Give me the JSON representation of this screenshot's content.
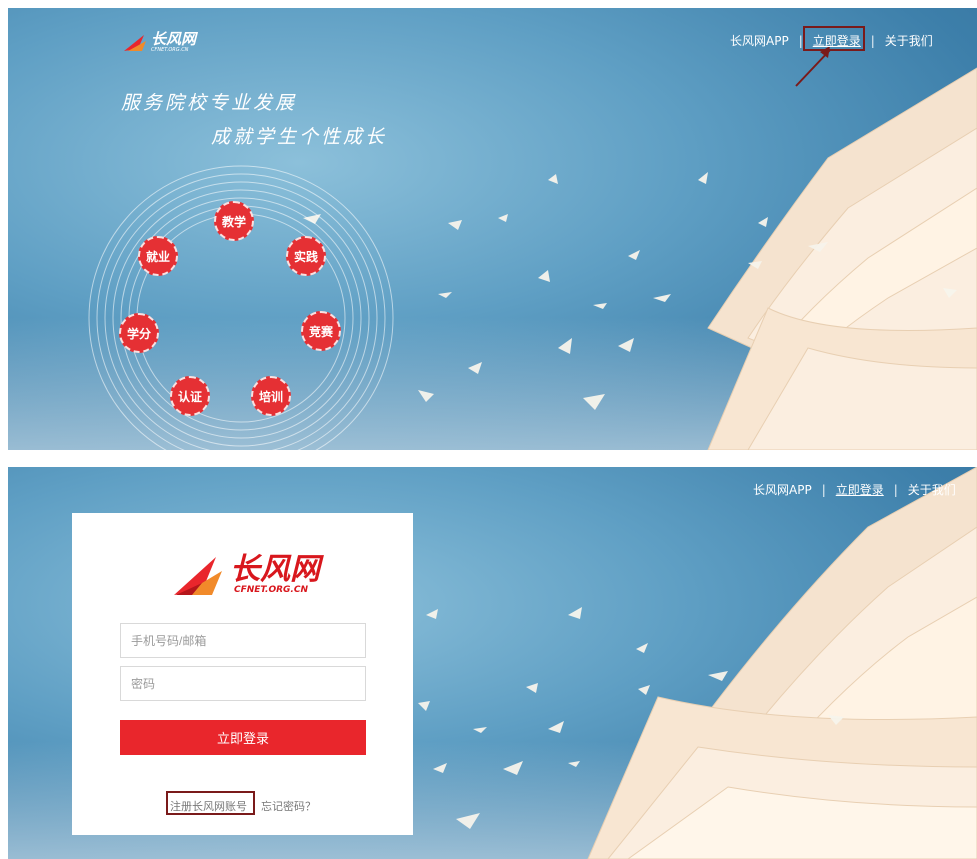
{
  "brand": {
    "name_cn": "长风网",
    "domain": "CFNET.ORG.CN",
    "accent_color": "#e9262c",
    "highlight_color": "#7a1a1a"
  },
  "nav": {
    "app_label": "长风网APP",
    "separator": "|",
    "login_label": "立即登录",
    "about_label": "关于我们"
  },
  "hero": {
    "slogan_line1": "服务院校专业发展",
    "slogan_line2": "成就学生个性成长",
    "circle_items": [
      "教学",
      "实践",
      "竞赛",
      "培训",
      "认证",
      "学分",
      "就业"
    ]
  },
  "login": {
    "phone_placeholder": "手机号码/邮箱",
    "password_placeholder": "密码",
    "submit_label": "立即登录",
    "register_label": "注册长风网账号",
    "forgot_label": "忘记密码？"
  }
}
